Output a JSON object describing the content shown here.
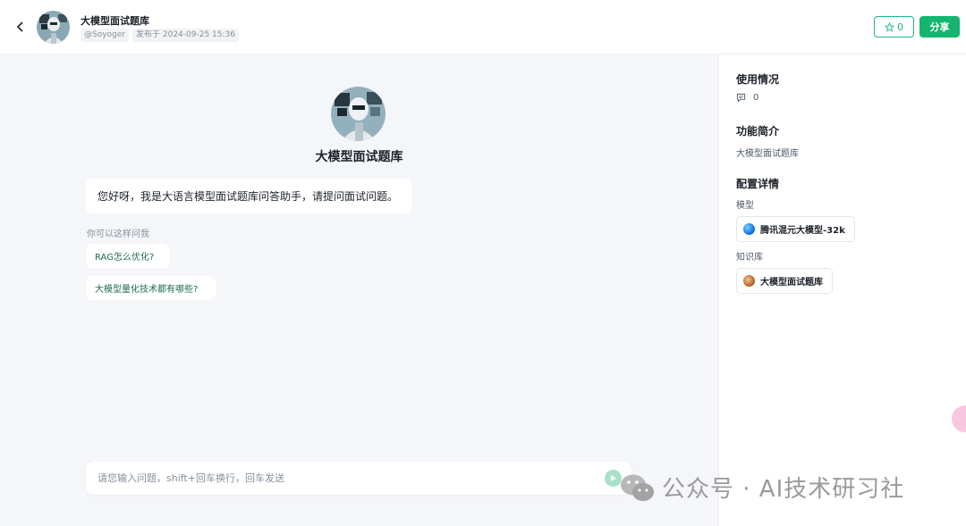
{
  "header": {
    "title": "大模型面试题库",
    "author": "@Soyoger",
    "published": "发布于 2024-09-25 15:36",
    "star_count": "0",
    "share_label": "分享"
  },
  "main": {
    "bot_name": "大模型面试题库",
    "greeting": "您好呀，我是大语言模型面试题库问答助手，请提问面试问题。",
    "suggest_label": "你可以这样问我",
    "suggestions": [
      "RAG怎么优化?",
      "大模型量化技术都有哪些?"
    ],
    "input_placeholder": "请您输入问题，shift+回车换行，回车发送"
  },
  "sidebar": {
    "usage_title": "使用情况",
    "usage_count": "0",
    "intro_title": "功能简介",
    "intro_text": "大模型面试题库",
    "config_title": "配置详情",
    "model_label": "模型",
    "model_name": "腾讯混元大模型-32k",
    "kb_label": "知识库",
    "kb_name": "大模型面试题库"
  },
  "watermark": {
    "text": "公众号 · AI技术研习社"
  },
  "colors": {
    "accent": "#15b56f",
    "accent_outline": "#1fb87a",
    "link": "#1d6b4e"
  },
  "icons": [
    "back-arrow-icon",
    "star-icon",
    "comment-icon",
    "send-icon",
    "hunyuan-model-icon",
    "knowledge-base-icon",
    "wechat-icon"
  ]
}
